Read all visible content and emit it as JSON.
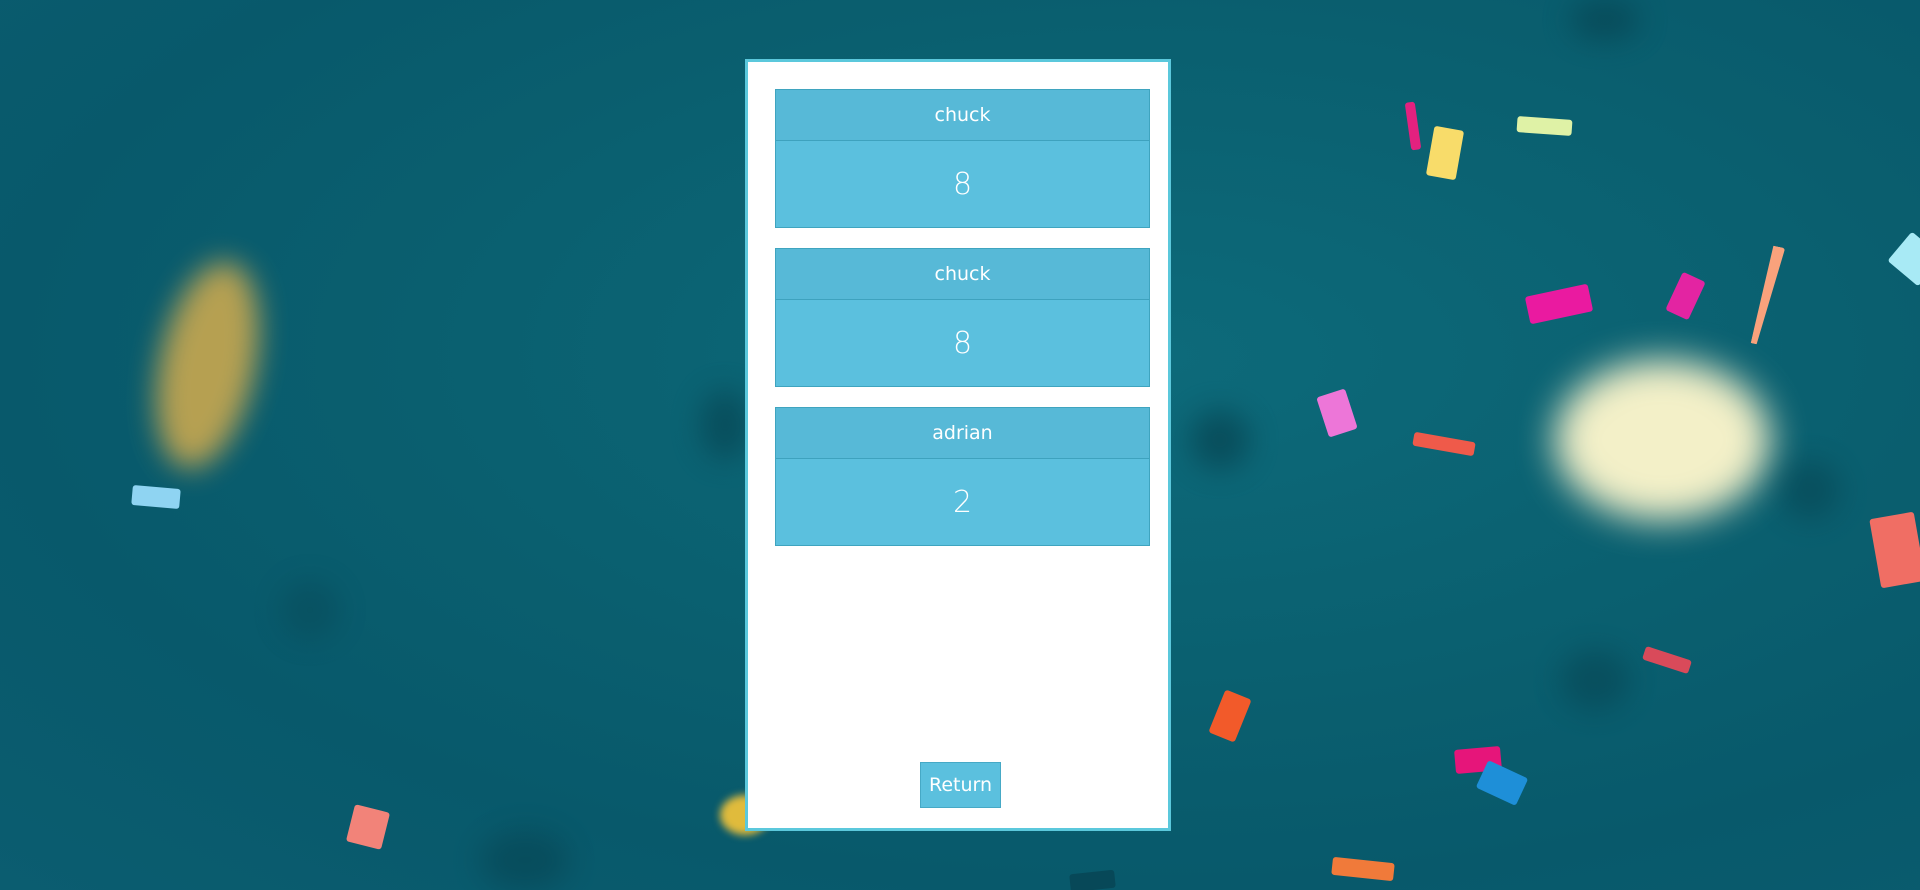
{
  "scores": [
    {
      "name": "chuck",
      "score": "8"
    },
    {
      "name": "chuck",
      "score": "8"
    },
    {
      "name": "adrian",
      "score": "2"
    }
  ],
  "actions": {
    "return_label": "Return"
  },
  "colors": {
    "background": "#0a5f6f",
    "panel": "#ffffff",
    "panel_border": "#5bc8dc",
    "card": "#5bc0de",
    "card_header": "#57b9d7",
    "button": "#5bc0de"
  }
}
